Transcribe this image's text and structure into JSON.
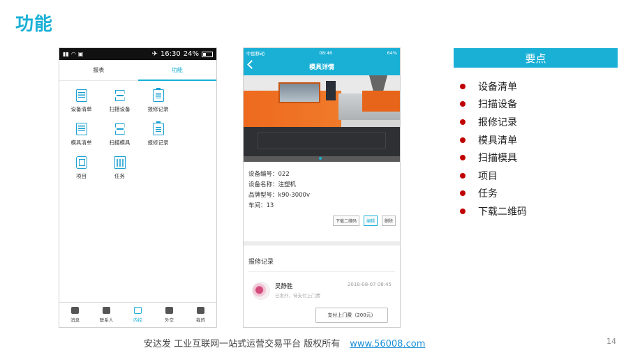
{
  "slide": {
    "title": "功能",
    "page_number": "14"
  },
  "phone1": {
    "status_time": "16:30",
    "status_battery": "24%",
    "tabs": [
      {
        "label": "报表"
      },
      {
        "label": "功能"
      }
    ],
    "features": [
      {
        "label": "设备清单",
        "icon": "list-icon"
      },
      {
        "label": "扫描设备",
        "icon": "scan-icon"
      },
      {
        "label": "报修记录",
        "icon": "clipboard-icon"
      },
      {
        "label": "模具清单",
        "icon": "list-icon"
      },
      {
        "label": "扫描模具",
        "icon": "scan-icon"
      },
      {
        "label": "报修记录",
        "icon": "clipboard-icon"
      },
      {
        "label": "项目",
        "icon": "project-icon"
      },
      {
        "label": "任务",
        "icon": "calendar-icon"
      }
    ],
    "bottom_nav": [
      {
        "label": "消息",
        "icon": "message-icon"
      },
      {
        "label": "联系人",
        "icon": "contacts-icon"
      },
      {
        "label": "内控",
        "icon": "internal-icon"
      },
      {
        "label": "外交",
        "icon": "grid-icon"
      },
      {
        "label": "我的",
        "icon": "user-icon"
      }
    ]
  },
  "phone2": {
    "status_carrier": "中国移动",
    "status_time": "08:46",
    "status_battery": "64%",
    "title": "模具详情",
    "info": [
      "设备编号：022",
      "设备名称：注塑机",
      "品牌型号：k90-3000v",
      "车间：13"
    ],
    "actions": {
      "download": "下载二维码",
      "edit": "编辑",
      "delete": "删除"
    },
    "section_title": "报修记录",
    "record": {
      "name": "吴静胜",
      "time": "2018-08-07 08:45",
      "status": "已发外，待支付上门费"
    },
    "pay_button": "支付上门费（200元）"
  },
  "key_points": {
    "title": "要点",
    "items": [
      "设备清单",
      "扫描设备",
      "报修记录",
      "模具清单",
      "扫描模具",
      "项目",
      "任务",
      "下载二维码"
    ]
  },
  "footer": {
    "text": "安达发   工业互联网一站式运营交易平台   版权所有",
    "link": "www.56008.com"
  },
  "colors": {
    "accent": "#1ab0d6",
    "bullet": "#c00000"
  }
}
